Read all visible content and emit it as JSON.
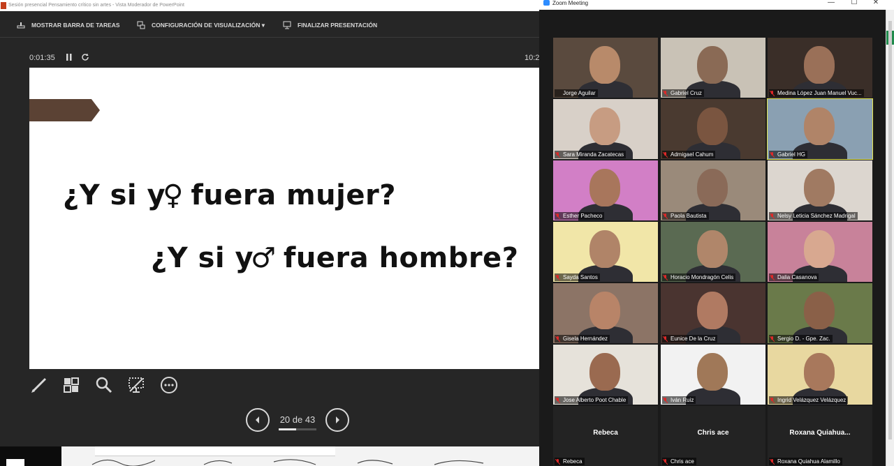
{
  "powerpoint": {
    "window_title": "Sesión presencial Pensamiento crítico sin artes - Vista Moderador de PowerPoint",
    "toolbar": {
      "taskbar_label": "MOSTRAR BARRA DE TAREAS",
      "display_settings_label": "CONFIGURACIÓN DE VISUALIZACIÓN ▾",
      "end_show_label": "FINALIZAR PRESENTACIÓN"
    },
    "timer": "0:01:35",
    "clock": "10:2",
    "slide": {
      "line1": "¿Y si y",
      "line1_symbol": "♀",
      "line1_end": " fuera mujer?",
      "line2": "¿Y si y",
      "line2_symbol": "♂",
      "line2_end": " fuera hombre?",
      "accent_color": "#5b4234"
    },
    "tools": [
      "pen-tool",
      "slides-grid",
      "zoom-magnifier",
      "black-screen",
      "more-options"
    ],
    "navigation": {
      "counter": "20 de 43",
      "current": 20,
      "total": 43
    }
  },
  "zoom": {
    "window_title": "Zoom Meeting",
    "participants": [
      {
        "name": "Jorge Aguilar",
        "muted": false,
        "bg": "#5a4a3e",
        "face": "#b88a6a"
      },
      {
        "name": "Gabriel Cruz",
        "muted": true,
        "bg": "#c9c2b6",
        "face": "#8a6a55"
      },
      {
        "name": "Medina López Juan Manuel Vuc...",
        "muted": true,
        "bg": "#3a2e28",
        "face": "#9a7058"
      },
      {
        "name": "Sara Miranda Zacatecas",
        "muted": true,
        "bg": "#d8d0c8",
        "face": "#c79c82"
      },
      {
        "name": "Admigael Cahum",
        "muted": true,
        "bg": "#4a3a30",
        "face": "#7a5540"
      },
      {
        "name": "Gabriel HG",
        "muted": true,
        "bg": "#8aa0b2",
        "face": "#b08468",
        "speaker": true
      },
      {
        "name": "Esther Pacheco",
        "muted": true,
        "bg": "#d27fc6",
        "face": "#a8765c"
      },
      {
        "name": "Paola Bautista",
        "muted": true,
        "bg": "#9a8a7a",
        "face": "#8a6a58"
      },
      {
        "name": "Nelsy Leticia Sánchez Madrigal",
        "muted": true,
        "bg": "#dcd6cf",
        "face": "#a07a62"
      },
      {
        "name": "Sayda Santos",
        "muted": true,
        "bg": "#f1e6a8",
        "face": "#b08468"
      },
      {
        "name": "Horacio Mondragón Celis",
        "muted": true,
        "bg": "#5a6a52",
        "face": "#b0866a"
      },
      {
        "name": "Dalia Casanova",
        "muted": true,
        "bg": "#c8829a",
        "face": "#d8a890"
      },
      {
        "name": "Gisela Hernández",
        "muted": true,
        "bg": "#8c7466",
        "face": "#b88468"
      },
      {
        "name": "Eunice De la Cruz",
        "muted": true,
        "bg": "#4a3430",
        "face": "#b07a62"
      },
      {
        "name": "Sergio D. - Gpe. Zac.",
        "muted": true,
        "bg": "#6a7a4a",
        "face": "#8a6048"
      },
      {
        "name": "Jose Alberto Poot Chable",
        "muted": true,
        "bg": "#e6e2da",
        "face": "#9a6a50"
      },
      {
        "name": "Iván Ruiz",
        "muted": true,
        "bg": "#f2f2f2",
        "face": "#a07858"
      },
      {
        "name": "Ingrid Velázquez Velázquez",
        "muted": true,
        "bg": "#e8d8a0",
        "face": "#a8785c"
      },
      {
        "name": "Rebeca",
        "muted": true,
        "video_off": true,
        "display": "Rebeca"
      },
      {
        "name": "Chris ace",
        "muted": true,
        "video_off": true,
        "display": "Chris ace"
      },
      {
        "name": "Roxana Quiahua Alamillo",
        "muted": true,
        "video_off": true,
        "display": "Roxana  Quiahua..."
      }
    ]
  }
}
